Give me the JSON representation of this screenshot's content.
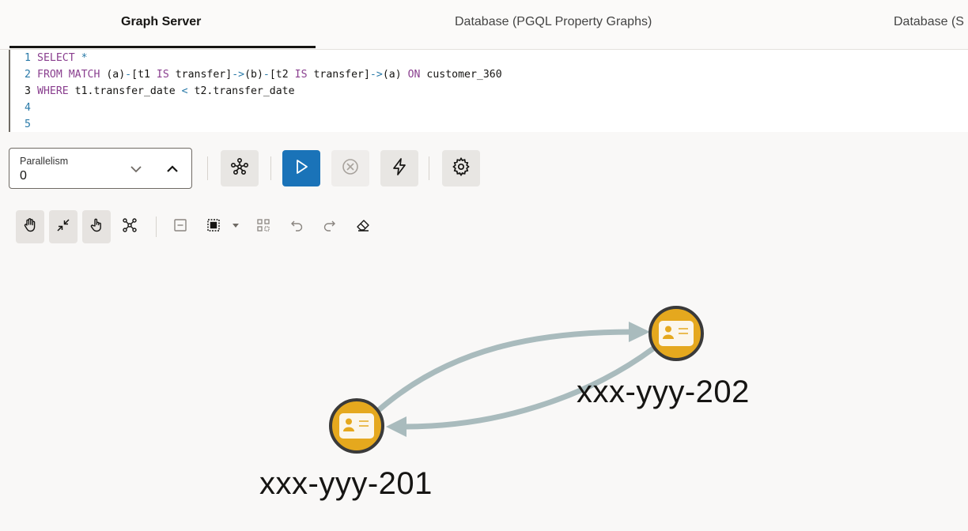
{
  "tabs": [
    {
      "label": "Graph Server",
      "active": true
    },
    {
      "label": "Database (PGQL Property Graphs)",
      "active": false
    },
    {
      "label": "Database (S",
      "active": false
    }
  ],
  "editor": {
    "lines": [
      {
        "num": "1",
        "tokens": [
          {
            "t": "SELECT",
            "c": "kw"
          },
          {
            "t": " *",
            "c": "op"
          }
        ]
      },
      {
        "num": "2",
        "tokens": [
          {
            "t": "FROM MATCH",
            "c": "kw"
          },
          {
            "t": " (a)",
            "c": "tx"
          },
          {
            "t": "-",
            "c": "op"
          },
          {
            "t": "[t1 ",
            "c": "tx"
          },
          {
            "t": "IS",
            "c": "kw"
          },
          {
            "t": " transfer]",
            "c": "tx"
          },
          {
            "t": "->",
            "c": "op"
          },
          {
            "t": "(b)",
            "c": "tx"
          },
          {
            "t": "-",
            "c": "op"
          },
          {
            "t": "[t2 ",
            "c": "tx"
          },
          {
            "t": "IS",
            "c": "kw"
          },
          {
            "t": " transfer]",
            "c": "tx"
          },
          {
            "t": "->",
            "c": "op"
          },
          {
            "t": "(a) ",
            "c": "tx"
          },
          {
            "t": "ON",
            "c": "kw"
          },
          {
            "t": " customer_360",
            "c": "tx"
          }
        ]
      },
      {
        "num": "3",
        "tokens": [
          {
            "t": "WHERE",
            "c": "kw"
          },
          {
            "t": " t1.transfer_date ",
            "c": "tx"
          },
          {
            "t": "<",
            "c": "op"
          },
          {
            "t": " t2.transfer_date",
            "c": "tx"
          }
        ]
      },
      {
        "num": "4",
        "tokens": []
      },
      {
        "num": "5",
        "tokens": []
      }
    ]
  },
  "parallelism": {
    "label": "Parallelism",
    "value": "0"
  },
  "toolbar": {
    "buttons": [
      "graph-schema",
      "run",
      "cancel",
      "quick-action",
      "settings"
    ]
  },
  "graph_toolbar": {
    "tools": [
      "pan-hand",
      "collapse",
      "select-hand",
      "network",
      "minus",
      "select-grid",
      "dropdown",
      "layout-grid",
      "undo",
      "redo",
      "eraser"
    ]
  },
  "graph": {
    "nodes": [
      {
        "id": "xxx-yyy-201",
        "label": "xxx-yyy-201"
      },
      {
        "id": "xxx-yyy-202",
        "label": "xxx-yyy-202"
      }
    ],
    "colors": {
      "node_fill": "#e5a81e",
      "node_stroke": "#3a3a3a",
      "edge": "#a9bbbd",
      "primary": "#1a73b8"
    }
  }
}
